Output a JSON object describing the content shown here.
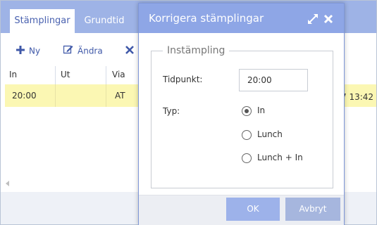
{
  "tabs": [
    {
      "label": "Stämplingar",
      "active": true
    },
    {
      "label": "Grundtid",
      "active": false
    }
  ],
  "toolbar": {
    "new_label": "Ny",
    "edit_label": "Ändra"
  },
  "grid": {
    "columns": [
      "In",
      "Ut",
      "Via"
    ],
    "rows": [
      {
        "in": "20:00",
        "ut": "",
        "via": "AT",
        "extra": "7 13:42"
      }
    ]
  },
  "dialog": {
    "title": "Korrigera stämplingar",
    "fieldset_legend": "Instämpling",
    "time_label": "Tidpunkt:",
    "time_value": "20:00",
    "type_label": "Typ:",
    "type_options": [
      {
        "label": "In",
        "selected": true
      },
      {
        "label": "Lunch",
        "selected": false
      },
      {
        "label": "Lunch + In",
        "selected": false
      }
    ],
    "ok_label": "OK",
    "cancel_label": "Avbryt"
  },
  "colors": {
    "header_blue": "#9eb3e6",
    "dialog_title_blue": "#8ea6e6",
    "row_highlight": "#fbf7b3",
    "button_blue": "#9db2ea"
  }
}
